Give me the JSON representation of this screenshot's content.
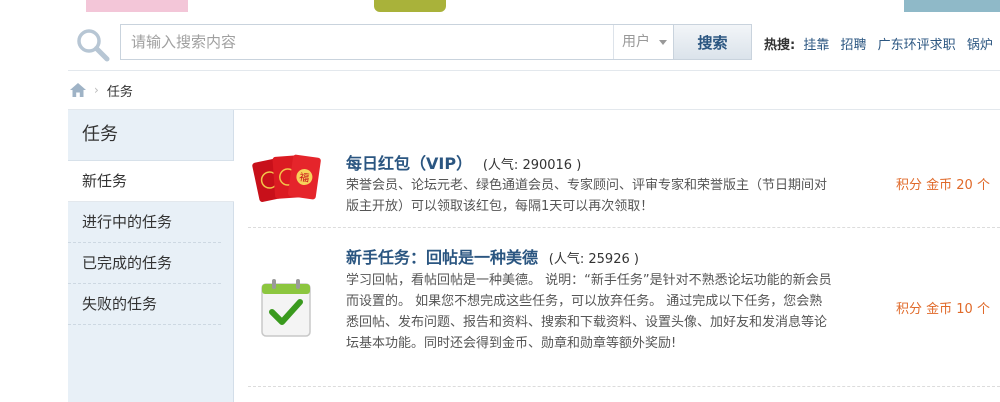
{
  "search": {
    "placeholder": "请输入搜索内容",
    "scope": "用户",
    "button_label": "搜索",
    "hot_label": "热搜:",
    "hot_links": [
      "挂靠",
      "招聘",
      "广东环评求职",
      "锅炉"
    ]
  },
  "breadcrumb": {
    "current": "任务"
  },
  "sidebar": {
    "title": "任务",
    "items": [
      {
        "label": "新任务",
        "active": true
      },
      {
        "label": "进行中的任务",
        "active": false
      },
      {
        "label": "已完成的任务",
        "active": false
      },
      {
        "label": "失败的任务",
        "active": false
      }
    ]
  },
  "tasks": [
    {
      "name": "每日红包（VIP）",
      "popularity": "(人气: 290016 )",
      "description": "荣誉会员、论坛元老、绿色通道会员、专家顾问、评审专家和荣誉版主（节日期间对版主开放）可以领取该红包，每隔1天可以再次领取！",
      "reward": "积分 金币 20 个",
      "icon": "red-envelope-icon"
    },
    {
      "name": "新手任务：回帖是一种美德",
      "popularity": "(人气: 25926 )",
      "description": "学习回帖，看帖回帖是一种美德。 说明：“新手任务”是针对不熟悉论坛功能的新会员而设置的。 如果您不想完成这些任务，可以放弃任务。 通过完成以下任务，您会熟悉回帖、发布问题、报告和资料、搜索和下载资料、设置头像、加好友和发消息等论坛基本功能。同时还会得到金币、勋章和勋章等额外奖励!",
      "reward": "积分 金币 10 个",
      "icon": "checklist-icon"
    }
  ],
  "colors": {
    "link": "#2b5681",
    "reward": "#e06a2a",
    "sidebar_bg": "#e8f0f7"
  }
}
